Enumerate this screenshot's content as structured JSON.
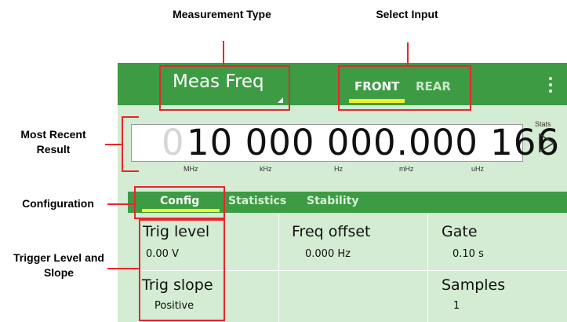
{
  "annotations": {
    "measurement_type": "Measurement Type",
    "select_input": "Select Input",
    "most_recent_result": "Most Recent Result",
    "configuration": "Configuration",
    "trigger_level_slope": "Trigger Level and Slope"
  },
  "topbar": {
    "title": "Meas Freq",
    "inputs": [
      "FRONT",
      "REAR"
    ],
    "selected_input": "FRONT",
    "menu_icon": "kebab-menu-icon"
  },
  "readout": {
    "leading_digit": "0",
    "value": "10 000 000.000 166",
    "units": [
      "MHz",
      "kHz",
      "Hz",
      "mHz",
      "uHz"
    ],
    "stats_label": "Stats",
    "stats_icon": "play-triangle-icon"
  },
  "tabs": {
    "items": [
      "Config",
      "Statistics",
      "Stability"
    ],
    "selected": "Config"
  },
  "config": {
    "trig_level": {
      "label": "Trig level",
      "value": "0.00 V"
    },
    "trig_slope": {
      "label": "Trig slope",
      "value": "Positive"
    },
    "freq_offset": {
      "label": "Freq offset",
      "value": "0.000 Hz"
    },
    "gate": {
      "label": "Gate",
      "value": "0.10 s"
    },
    "samples": {
      "label": "Samples",
      "value": "1"
    }
  },
  "colors": {
    "panel_green": "#3d9c43",
    "panel_light": "#d3ecd3",
    "accent_yellow": "#f2ef2e",
    "annotation_red": "#e8262b"
  }
}
